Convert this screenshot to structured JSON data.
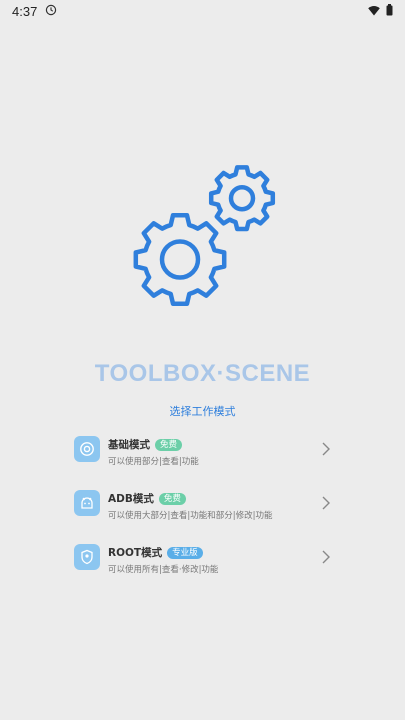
{
  "status_bar": {
    "time": "4:37",
    "icons": [
      "alarm-clock-icon",
      "wifi-icon",
      "battery-icon"
    ]
  },
  "app": {
    "logo_icon": "gears-icon",
    "title": "TOOLBOX·SCENE",
    "subtitle": "选择工作模式"
  },
  "modes": [
    {
      "title": "基础模式",
      "badge": "免费",
      "description": "可以使用部分|查看|功能",
      "icon": "basic-mode-icon"
    },
    {
      "title": "ADB模式",
      "badge": "免费",
      "description": "可以使用大部分|查看|功能和部分|修改|功能",
      "icon": "android-adb-icon"
    },
    {
      "title": "ROOT模式",
      "badge": "专业版",
      "description": "可以使用所有|查看·修改|功能",
      "icon": "root-shield-icon"
    }
  ],
  "colors": {
    "background": "#ececec",
    "gear": "#2f7fdc",
    "title": "#a9c6e8",
    "accent": "#2f7fdc",
    "icon_bg": "#8cc6f0",
    "badge_free": "#6ccfa8",
    "badge_pro": "#5aaee8"
  }
}
